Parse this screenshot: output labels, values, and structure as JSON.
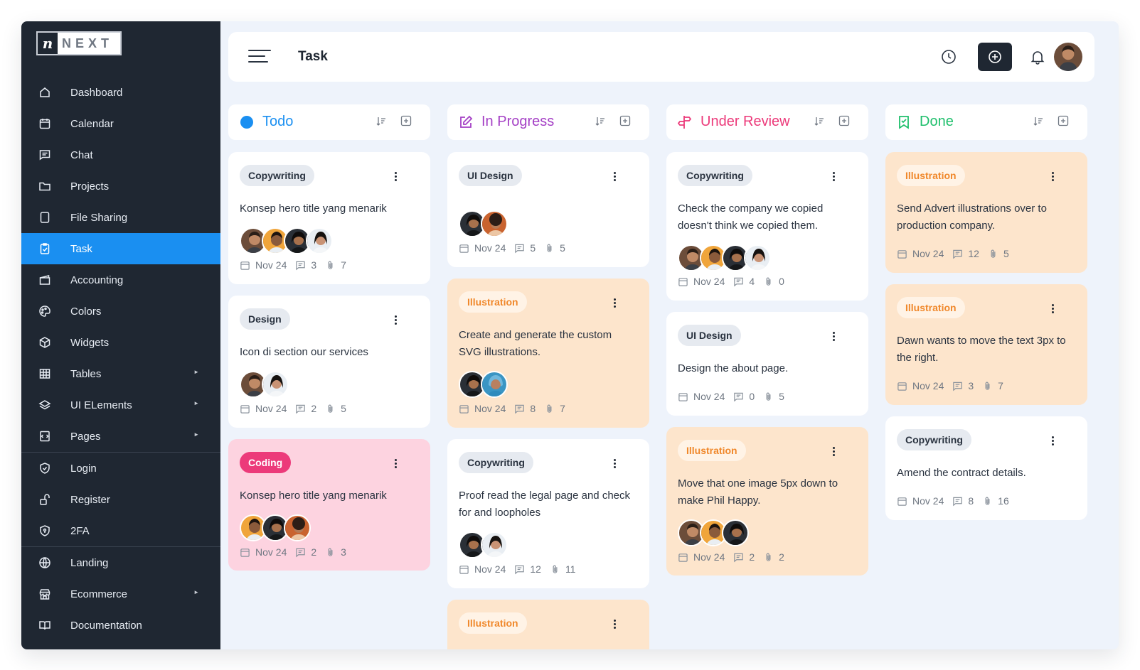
{
  "app": {
    "logo_mark": "n",
    "logo_word": "NEXT"
  },
  "sidebar": {
    "items": [
      {
        "label": "Dashboard",
        "icon": "home-icon"
      },
      {
        "label": "Calendar",
        "icon": "calendar-icon"
      },
      {
        "label": "Chat",
        "icon": "chat-icon"
      },
      {
        "label": "Projects",
        "icon": "folder-icon"
      },
      {
        "label": "File Sharing",
        "icon": "file-icon"
      },
      {
        "label": "Task",
        "icon": "clipboard-icon",
        "active": true
      },
      {
        "label": "Accounting",
        "icon": "wallet-icon"
      },
      {
        "label": "Colors",
        "icon": "palette-icon"
      },
      {
        "label": "Widgets",
        "icon": "cube-icon"
      },
      {
        "label": "Tables",
        "icon": "table-icon",
        "arrow": true
      },
      {
        "label": "UI ELements",
        "icon": "layers-icon",
        "arrow": true
      },
      {
        "label": "Pages",
        "icon": "pages-icon",
        "arrow": true
      },
      {
        "label": "Login",
        "icon": "shield-icon"
      },
      {
        "label": "Register",
        "icon": "lock-open-icon"
      },
      {
        "label": "2FA",
        "icon": "shield-lock-icon"
      },
      {
        "label": "Landing",
        "icon": "globe-icon"
      },
      {
        "label": "Ecommerce",
        "icon": "store-icon",
        "arrow": true
      },
      {
        "label": "Documentation",
        "icon": "book-icon"
      }
    ]
  },
  "header": {
    "title": "Task"
  },
  "colors": {
    "accent": "#1a8ff1",
    "sidebar_bg": "#1f2732",
    "todo": "#1a8ff1",
    "in_progress": "#a43fc5",
    "under_review": "#ec3a7a",
    "done": "#1fbf6c"
  },
  "columns": [
    {
      "title": "Todo",
      "cards": [
        {
          "tag": "Copywriting",
          "text": "Konsep hero title yang menarik",
          "date": "Nov 24",
          "comments": "3",
          "attachments": "7"
        },
        {
          "tag": "Design",
          "text": "Icon di section our services",
          "date": "Nov 24",
          "comments": "2",
          "attachments": "5"
        },
        {
          "tag": "Coding",
          "text": "Konsep hero title yang menarik",
          "date": "Nov 24",
          "comments": "2",
          "attachments": "3"
        }
      ]
    },
    {
      "title": "In Progress",
      "cards": [
        {
          "tag": "UI Design",
          "text": "",
          "date": "Nov 24",
          "comments": "5",
          "attachments": "5"
        },
        {
          "tag": "Illustration",
          "text": "Create and generate the custom SVG illustrations.",
          "date": "Nov 24",
          "comments": "8",
          "attachments": "7"
        },
        {
          "tag": "Copywriting",
          "text": "Proof read the legal page and check for and loopholes",
          "date": "Nov 24",
          "comments": "12",
          "attachments": "11"
        },
        {
          "tag": "Illustration"
        }
      ]
    },
    {
      "title": "Under Review",
      "cards": [
        {
          "tag": "Copywriting",
          "text": "Check the company we copied doesn't think we copied them.",
          "date": "Nov 24",
          "comments": "4",
          "attachments": "0"
        },
        {
          "tag": "UI Design",
          "text": "Design the about page.",
          "date": "Nov 24",
          "comments": "0",
          "attachments": "5"
        },
        {
          "tag": "Illustration",
          "text": "Move that one image 5px down to make Phil Happy.",
          "date": "Nov 24",
          "comments": "2",
          "attachments": "2"
        }
      ]
    },
    {
      "title": "Done",
      "cards": [
        {
          "tag": "Illustration",
          "text": "Send Advert illustrations over to production company.",
          "date": "Nov 24",
          "comments": "12",
          "attachments": "5"
        },
        {
          "tag": "Illustration",
          "text": "Dawn wants to move the text 3px to the right.",
          "date": "Nov 24",
          "comments": "3",
          "attachments": "7"
        },
        {
          "tag": "Copywriting",
          "text": "Amend the contract details.",
          "date": "Nov 24",
          "comments": "8",
          "attachments": "16"
        }
      ]
    }
  ]
}
